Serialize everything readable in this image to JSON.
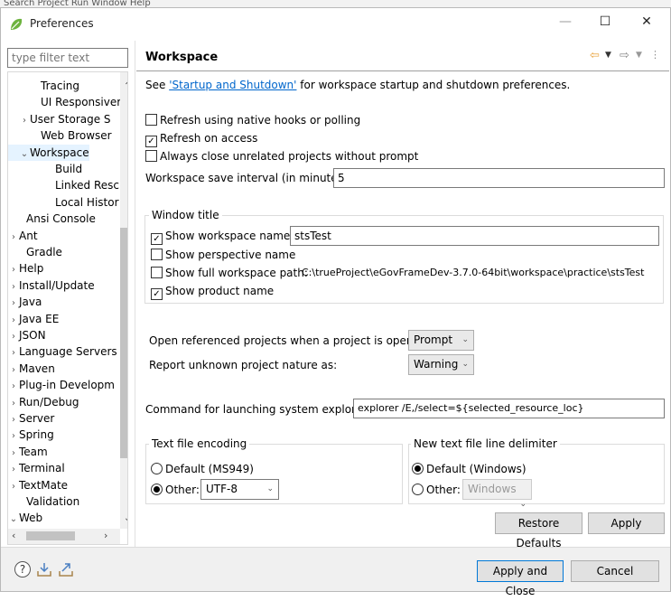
{
  "background_menu": "Search  Project  Run  Window  Help",
  "window": {
    "title": "Preferences",
    "minimize": "—",
    "maximize": "☐",
    "close": "✕"
  },
  "filter": {
    "placeholder": "type filter text"
  },
  "tree": [
    {
      "label": "Tracing",
      "indent": 36,
      "toggle": ""
    },
    {
      "label": "UI Responsiver",
      "indent": 36,
      "toggle": ""
    },
    {
      "label": "User Storage S",
      "indent": 24,
      "toggle": "›"
    },
    {
      "label": "Web Browser",
      "indent": 36,
      "toggle": ""
    },
    {
      "label": "Workspace",
      "indent": 24,
      "toggle": "⌄",
      "selected": true
    },
    {
      "label": "Build",
      "indent": 52,
      "toggle": ""
    },
    {
      "label": "Linked Resc",
      "indent": 52,
      "toggle": ""
    },
    {
      "label": "Local Histor",
      "indent": 52,
      "toggle": ""
    },
    {
      "label": "Ansi Console",
      "indent": 20,
      "toggle": ""
    },
    {
      "label": "Ant",
      "indent": 8,
      "toggle": "›"
    },
    {
      "label": "Gradle",
      "indent": 20,
      "toggle": ""
    },
    {
      "label": "Help",
      "indent": 8,
      "toggle": "›"
    },
    {
      "label": "Install/Update",
      "indent": 8,
      "toggle": "›"
    },
    {
      "label": "Java",
      "indent": 8,
      "toggle": "›"
    },
    {
      "label": "Java EE",
      "indent": 8,
      "toggle": "›"
    },
    {
      "label": "JSON",
      "indent": 8,
      "toggle": "›"
    },
    {
      "label": "Language Servers",
      "indent": 8,
      "toggle": "›"
    },
    {
      "label": "Maven",
      "indent": 8,
      "toggle": "›"
    },
    {
      "label": "Plug-in Developm",
      "indent": 8,
      "toggle": "›"
    },
    {
      "label": "Run/Debug",
      "indent": 8,
      "toggle": "›"
    },
    {
      "label": "Server",
      "indent": 8,
      "toggle": "›"
    },
    {
      "label": "Spring",
      "indent": 8,
      "toggle": "›"
    },
    {
      "label": "Team",
      "indent": 8,
      "toggle": "›"
    },
    {
      "label": "Terminal",
      "indent": 8,
      "toggle": "›"
    },
    {
      "label": "TextMate",
      "indent": 8,
      "toggle": "›"
    },
    {
      "label": "Validation",
      "indent": 20,
      "toggle": ""
    },
    {
      "label": "Web",
      "indent": 8,
      "toggle": "⌄"
    }
  ],
  "page": {
    "title": "Workspace",
    "see_prefix": "See ",
    "see_link": "'Startup and Shutdown'",
    "see_suffix": " for workspace startup and shutdown preferences.",
    "refresh_native": {
      "label": "Refresh using native hooks or polling",
      "checked": false
    },
    "refresh_access": {
      "label": "Refresh on access",
      "checked": true
    },
    "always_close": {
      "label": "Always close unrelated projects without prompt",
      "checked": false
    },
    "save_interval": {
      "label": "Workspace save interval (in minutes):",
      "value": "5"
    },
    "window_title": {
      "group_label": "Window title",
      "show_name": {
        "label": "Show workspace name:",
        "checked": true,
        "value": "stsTest"
      },
      "show_perspective": {
        "label": "Show perspective name",
        "checked": false
      },
      "show_full_path": {
        "label": "Show full workspace path:",
        "checked": false,
        "value": "C:\\trueProject\\eGovFrameDev-3.7.0-64bit\\workspace\\practice\\stsTest"
      },
      "show_product": {
        "label": "Show product name",
        "checked": true
      }
    },
    "open_referenced": {
      "label": "Open referenced projects when a project is opened:",
      "value": "Prompt"
    },
    "report_nature": {
      "label": "Report unknown project nature as:",
      "value": "Warning"
    },
    "explorer": {
      "label": "Command for launching system explorer:",
      "value": "explorer /E,/select=${selected_resource_loc}"
    },
    "encoding": {
      "group_label": "Text file encoding",
      "default_label": "Default (MS949)",
      "other_label": "Other:",
      "other_value": "UTF-8",
      "selected": "other"
    },
    "delimiter": {
      "group_label": "New text file line delimiter",
      "default_label": "Default (Windows)",
      "other_label": "Other:",
      "other_value": "Windows",
      "selected": "default"
    },
    "restore_defaults": "Restore Defaults",
    "apply": "Apply"
  },
  "footer": {
    "apply_close": "Apply and Close",
    "cancel": "Cancel",
    "help_icon": "?"
  },
  "colors": {
    "link": "#0066cc",
    "selection": "#e5f3ff",
    "default_button_border": "#0078d7"
  }
}
